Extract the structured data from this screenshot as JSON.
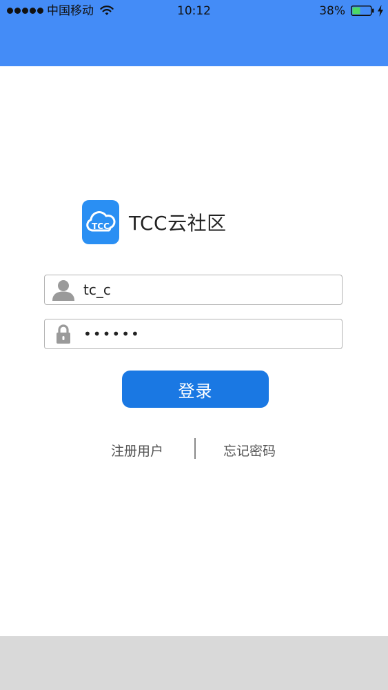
{
  "status_bar": {
    "carrier": "中国移动",
    "time": "10:12",
    "battery_percent": "38%"
  },
  "app": {
    "icon_text": "TCC",
    "name": "TCC云社区"
  },
  "login_form": {
    "username_value": "tc_c",
    "password_value": "••••••",
    "submit_label": "登录"
  },
  "links": {
    "register_label": "注册用户",
    "forgot_label": "忘记密码"
  },
  "colors": {
    "header_blue": "#448cf7",
    "button_blue": "#1a78e3",
    "battery_green": "#4cd964",
    "bottom_gray": "#d9d9d9"
  },
  "icons": {
    "wifi": "wifi-icon",
    "battery": "battery-icon",
    "charging": "charging-bolt-icon",
    "user": "user-icon",
    "lock": "lock-icon",
    "cloud": "cloud-icon"
  }
}
